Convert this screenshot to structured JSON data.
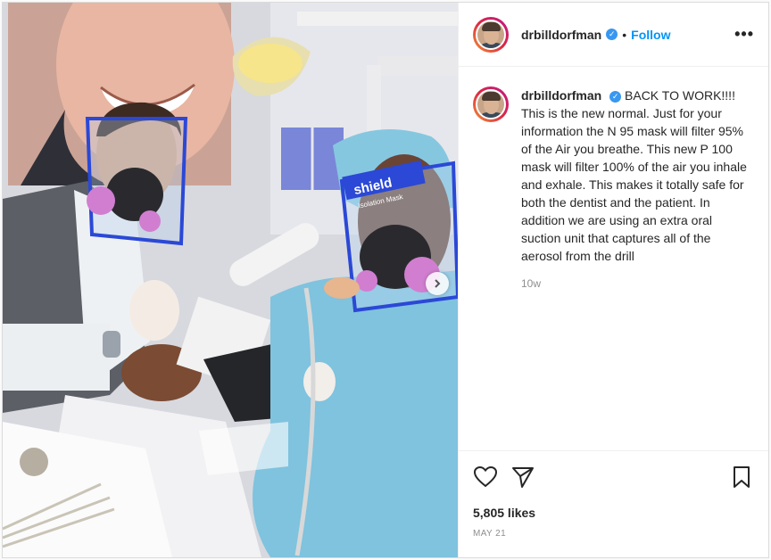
{
  "post": {
    "username": "drbilldorfman",
    "verified_label": "✓",
    "dot": "•",
    "follow_label": "Follow",
    "more_label": "•••",
    "caption": "BACK TO WORK!!!! This is the new normal. Just for your information the N 95 mask will filter 95% of the Air you breathe. This new P 100 mask will filter 100% of the air you inhale and exhale. This makes it totally safe for both the dentist and the patient. In addition we are using an extra oral suction unit that captures all of the aerosol from the drill",
    "time_ago": "10w",
    "likes": "5,805 likes",
    "date": "MAY 21",
    "photo_text": {
      "shield_label": "shield",
      "shield_sublabel": "Isolation Mask"
    },
    "icons": {
      "like": "heart-icon",
      "share": "paper-plane-icon",
      "save": "bookmark-icon",
      "next": "chevron-right-icon"
    }
  }
}
